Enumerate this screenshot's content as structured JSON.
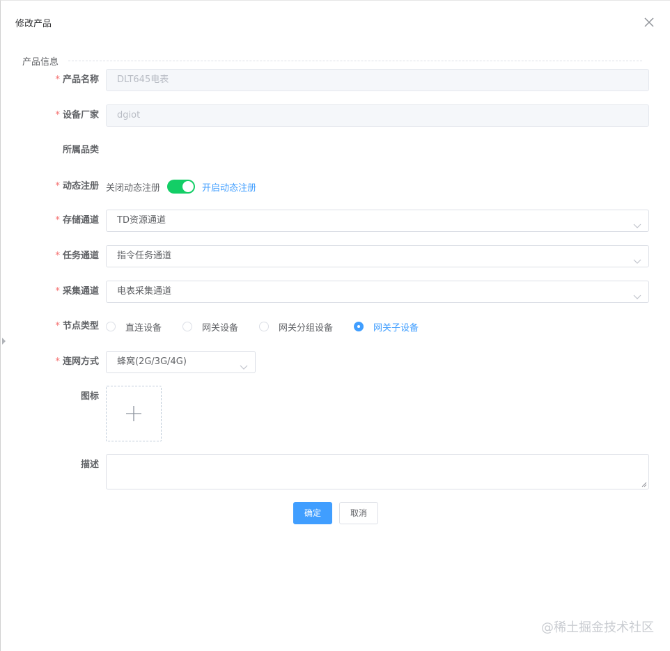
{
  "dialog": {
    "title": "修改产品",
    "section_title": "产品信息"
  },
  "form": {
    "product_name": {
      "label": "产品名称",
      "value": "DLT645电表",
      "required": true,
      "disabled": true
    },
    "vendor": {
      "label": "设备厂家",
      "value": "dgiot",
      "required": true,
      "disabled": true
    },
    "category": {
      "label": "所属品类",
      "value": ""
    },
    "dynamic_register": {
      "label": "动态注册",
      "off_text": "关闭动态注册",
      "on_text": "开启动态注册",
      "enabled": true
    },
    "storage_channel": {
      "label": "存储通道",
      "value": "TD资源通道"
    },
    "task_channel": {
      "label": "任务通道",
      "value": "指令任务通道"
    },
    "collect_channel": {
      "label": "采集通道",
      "value": "电表采集通道"
    },
    "node_type": {
      "label": "节点类型",
      "options": [
        "直连设备",
        "网关设备",
        "网关分组设备",
        "网关子设备"
      ],
      "selected": "网关子设备"
    },
    "network": {
      "label": "连网方式",
      "value": "蜂窝(2G/3G/4G)"
    },
    "icon": {
      "label": "图标"
    },
    "description": {
      "label": "描述",
      "value": ""
    }
  },
  "buttons": {
    "confirm": "确定",
    "cancel": "取消"
  },
  "watermark": "@稀土掘金技术社区",
  "colors": {
    "primary": "#409eff",
    "switch_on": "#13ce66",
    "required": "#f56c6c"
  }
}
